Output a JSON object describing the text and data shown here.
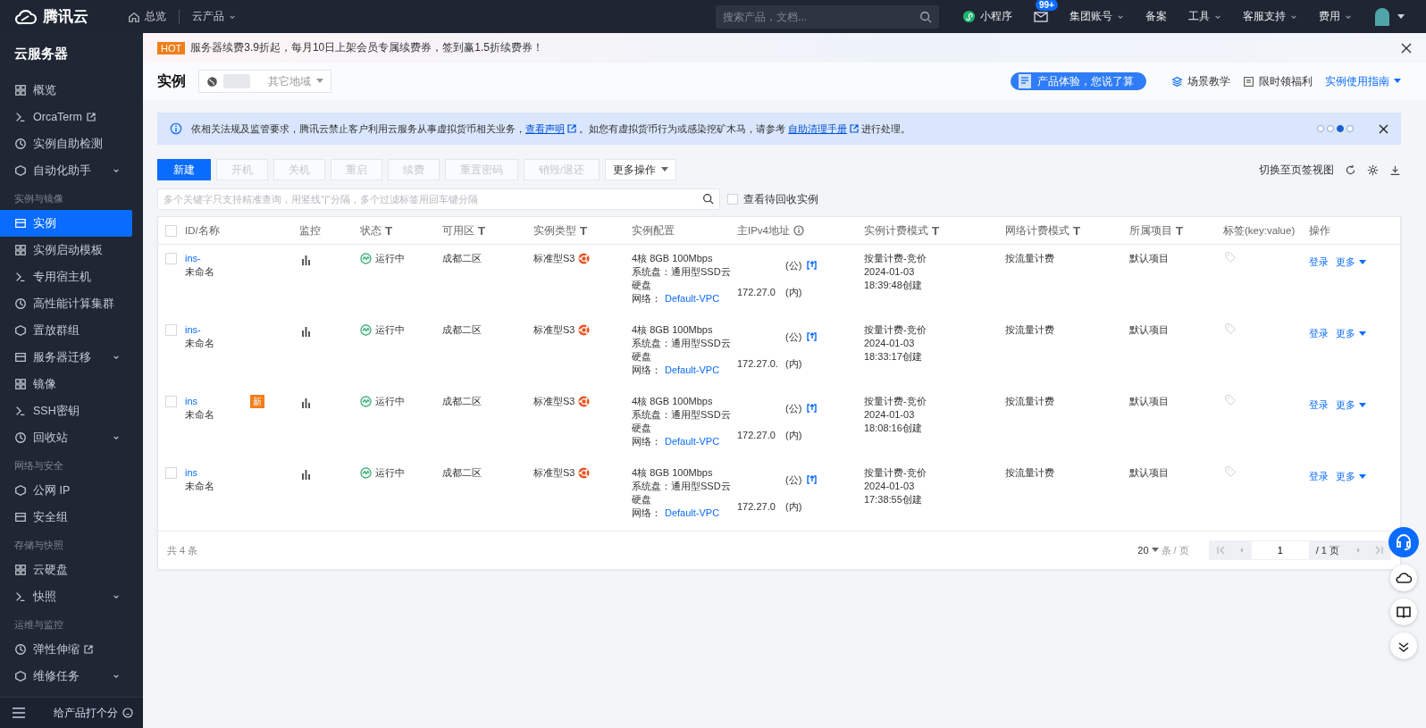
{
  "topbar": {
    "logo": "腾讯云",
    "nav": [
      {
        "label": "总览",
        "kind": "home"
      },
      {
        "label": "云产品",
        "kind": "dropdown"
      }
    ],
    "search": {
      "placeholder": "搜索产品，文档..."
    },
    "links": [
      {
        "label": "小程序",
        "kind": "miniapp"
      },
      {
        "kind": "mail",
        "badge": "99+"
      },
      {
        "label": "集团账号",
        "kind": "dropdown"
      },
      {
        "label": "备案",
        "kind": "plain"
      },
      {
        "label": "工具",
        "kind": "dropdown"
      },
      {
        "label": "客服支持",
        "kind": "dropdown"
      },
      {
        "label": "费用",
        "kind": "dropdown"
      },
      {
        "kind": "avatar"
      }
    ]
  },
  "sidebar": {
    "title": "云服务器",
    "sections": [
      {
        "items": [
          {
            "label": "概览",
            "selected": false,
            "expandable": false,
            "external": false
          },
          {
            "label": "OrcaTerm",
            "selected": false,
            "expandable": false,
            "external": true
          },
          {
            "label": "实例自助检测",
            "selected": false,
            "expandable": false,
            "external": false
          },
          {
            "label": "自动化助手",
            "selected": false,
            "expandable": true,
            "external": false
          }
        ]
      },
      {
        "heading": "实例与镜像",
        "items": [
          {
            "label": "实例",
            "selected": true,
            "expandable": false,
            "external": false
          },
          {
            "label": "实例启动模板",
            "selected": false,
            "expandable": false,
            "external": false
          },
          {
            "label": "专用宿主机",
            "selected": false,
            "expandable": false,
            "external": false
          },
          {
            "label": "高性能计算集群",
            "selected": false,
            "expandable": false,
            "external": false
          },
          {
            "label": "置放群组",
            "selected": false,
            "expandable": false,
            "external": false
          },
          {
            "label": "服务器迁移",
            "selected": false,
            "expandable": true,
            "external": false
          },
          {
            "label": "镜像",
            "selected": false,
            "expandable": false,
            "external": false
          },
          {
            "label": "SSH密钥",
            "selected": false,
            "expandable": false,
            "external": false
          },
          {
            "label": "回收站",
            "selected": false,
            "expandable": true,
            "external": false
          }
        ]
      },
      {
        "heading": "网络与安全",
        "items": [
          {
            "label": "公网 IP",
            "selected": false,
            "expandable": false,
            "external": false
          },
          {
            "label": "安全组",
            "selected": false,
            "expandable": false,
            "external": false
          }
        ]
      },
      {
        "heading": "存储与快照",
        "items": [
          {
            "label": "云硬盘",
            "selected": false,
            "expandable": false,
            "external": false
          },
          {
            "label": "快照",
            "selected": false,
            "expandable": true,
            "external": false
          }
        ]
      },
      {
        "heading": "运维与监控",
        "items": [
          {
            "label": "弹性伸缩",
            "selected": false,
            "expandable": false,
            "external": true
          },
          {
            "label": "维修任务",
            "selected": false,
            "expandable": true,
            "external": false
          }
        ]
      }
    ],
    "footer": "给产品打个分"
  },
  "promo": {
    "tag": "HOT",
    "text": "服务器续费3.9折起，每月10日上架会员专属续费券，签到赢1.5折续费券！"
  },
  "header": {
    "title": "实例",
    "region": "其它地域",
    "feedback": "产品体验，您说了算",
    "links": [
      {
        "label": "场景教学",
        "kind": "layers"
      },
      {
        "label": "限时领福利",
        "kind": "gift"
      },
      {
        "label": "实例使用指南",
        "kind": "dropdown"
      }
    ]
  },
  "notice": {
    "text": "依相关法规及监管要求，腾讯云禁止客户利用云服务从事虚拟货币相关业务，",
    "link1": "查看声明",
    "text2": "。如您有虚拟货币行为或感染挖矿木马，请参考",
    "link2": "自助清理手册",
    "text3": "进行处理。",
    "dots": [
      {
        "selected": false
      },
      {
        "selected": false
      },
      {
        "selected": true
      },
      {
        "selected": false
      }
    ]
  },
  "toolbar": {
    "buttons": [
      {
        "label": "新建",
        "kind": "primary",
        "disabled": false
      },
      {
        "label": "开机",
        "kind": "default",
        "disabled": true
      },
      {
        "label": "关机",
        "kind": "default",
        "disabled": true
      },
      {
        "label": "重启",
        "kind": "default",
        "disabled": true
      },
      {
        "label": "续费",
        "kind": "default",
        "disabled": true
      },
      {
        "label": "重置密码",
        "kind": "default",
        "disabled": true
      },
      {
        "label": "销毁/退还",
        "kind": "default",
        "disabled": true
      },
      {
        "label": "更多操作",
        "kind": "dropdown",
        "disabled": false
      }
    ],
    "view_switch": "切换至页签视图",
    "search": {
      "placeholder": "多个关键字只支持精准查询，用竖线\"|\"分隔，多个过滤标签用回车键分隔"
    },
    "recycle": {
      "label": "查看待回收实例",
      "checked": false
    }
  },
  "table": {
    "select_all": {
      "checked": false
    },
    "columns": [
      {
        "label": "ID/名称",
        "filter": false,
        "info": false
      },
      {
        "label": "监控",
        "filter": false,
        "info": false
      },
      {
        "label": "状态",
        "filter": true,
        "info": false
      },
      {
        "label": "可用区",
        "filter": true,
        "info": false
      },
      {
        "label": "实例类型",
        "filter": true,
        "info": false
      },
      {
        "label": "实例配置",
        "filter": false,
        "info": false
      },
      {
        "label": "主IPv4地址",
        "filter": false,
        "info": true
      },
      {
        "label": "实例计费模式",
        "filter": true,
        "info": false
      },
      {
        "label": "网络计费模式",
        "filter": true,
        "info": false
      },
      {
        "label": "所属项目",
        "filter": true,
        "info": false
      },
      {
        "label": "标签(key:value)",
        "filter": false,
        "info": false
      },
      {
        "label": "操作",
        "filter": false,
        "info": false
      }
    ],
    "rows": [
      {
        "selected": false,
        "id": "ins-",
        "name": "未命名",
        "status": "运行中",
        "zone": "成都二区",
        "type": "标准型S3",
        "config": "4核 8GB 100Mbps",
        "disk": "系统盘：通用型SSD云硬盘",
        "network_label": "网络：",
        "network": "Default-VPC",
        "public_label": "(公)",
        "private_ip": "172.27.0",
        "private_label": "(内)",
        "billing": "按量计费-竞价",
        "date": "2024-01-03",
        "created": "18:39:48创建",
        "net_billing": "按流量计费",
        "project": "默认项目",
        "login": "登录",
        "more": "更多"
      },
      {
        "selected": false,
        "id": "ins-",
        "name": "未命名",
        "status": "运行中",
        "zone": "成都二区",
        "type": "标准型S3",
        "config": "4核 8GB 100Mbps",
        "disk": "系统盘：通用型SSD云硬盘",
        "network_label": "网络：",
        "network": "Default-VPC",
        "public_label": "(公)",
        "private_ip": "172.27.0.",
        "private_label": "(内)",
        "billing": "按量计费-竞价",
        "date": "2024-01-03",
        "created": "18:33:17创建",
        "net_billing": "按流量计费",
        "project": "默认项目",
        "login": "登录",
        "more": "更多"
      },
      {
        "selected": false,
        "id": "ins",
        "name": "未命名",
        "badge": "新",
        "status": "运行中",
        "zone": "成都二区",
        "type": "标准型S3",
        "config": "4核 8GB 100Mbps",
        "disk": "系统盘：通用型SSD云硬盘",
        "network_label": "网络：",
        "network": "Default-VPC",
        "public_label": "(公)",
        "private_ip": "172.27.0",
        "private_label": "(内)",
        "billing": "按量计费-竞价",
        "date": "2024-01-03",
        "created": "18:08:16创建",
        "net_billing": "按流量计费",
        "project": "默认项目",
        "login": "登录",
        "more": "更多"
      },
      {
        "selected": false,
        "id": "ins",
        "name": "未命名",
        "status": "运行中",
        "zone": "成都二区",
        "type": "标准型S3",
        "config": "4核 8GB 100Mbps",
        "disk": "系统盘：通用型SSD云硬盘",
        "network_label": "网络：",
        "network": "Default-VPC",
        "public_label": "(公)",
        "private_ip": "172.27.0",
        "private_label": "(内)",
        "billing": "按量计费-竞价",
        "date": "2024-01-03",
        "created": "17:38:55创建",
        "net_billing": "按流量计费",
        "project": "默认项目",
        "login": "登录",
        "more": "更多"
      }
    ],
    "footer": {
      "total": "共 4 条",
      "page_size": "20",
      "per_page": "条 / 页",
      "page": "1",
      "pages": "/ 1 页"
    }
  }
}
